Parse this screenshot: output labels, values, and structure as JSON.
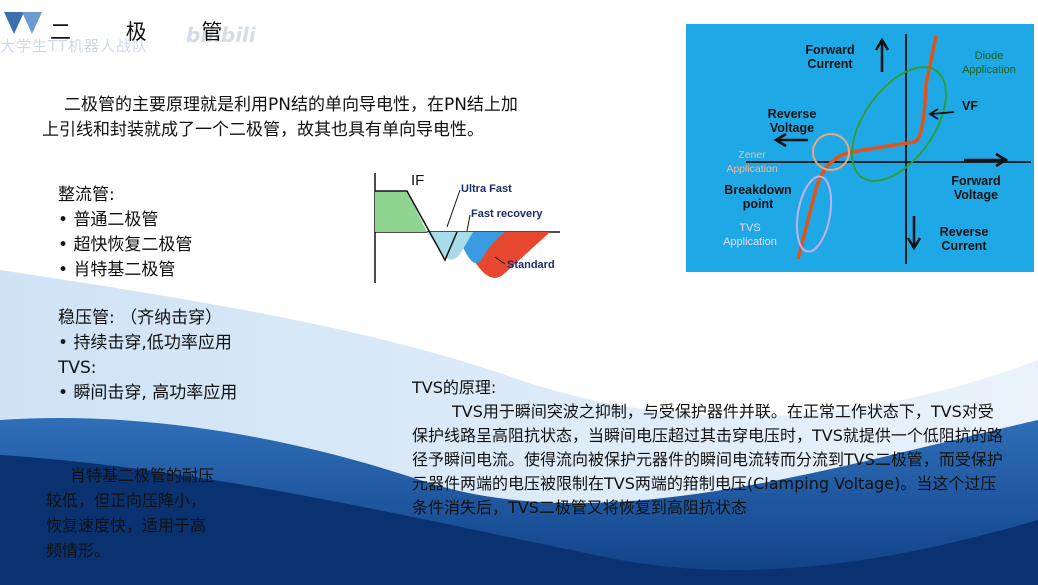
{
  "slide": {
    "title": "二 极 管",
    "watermark": "大学生TT机器人战队",
    "platform_logo": "bilibili"
  },
  "intro": "二极管的主要原理就是利用PN结的单向导电性，在PN结上加上引线和封装就成了一个二极管，故其也具有单向导电性。",
  "rectifier": {
    "heading": "整流管:",
    "items": [
      "普通二极管",
      "超快恢复二极管",
      "肖特基二极管"
    ]
  },
  "regulator": {
    "heading": "稳压管: （齐纳击穿）",
    "items": [
      "持续击穿,低功率应用"
    ],
    "tvs_heading": "TVS:",
    "tvs_items": [
      "瞬间击穿, 高功率应用"
    ]
  },
  "schottky_note": "肖特基二极管的耐压较低，但正向压降小，恢复速度快，适用于高频情形。",
  "tvs_principle": {
    "heading": "TVS的原理:",
    "body": "TVS用于瞬间突波之抑制，与受保护器件并联。在正常工作状态下，TVS对受保护线路呈高阻抗状态，当瞬间电压超过其击穿电压时，TVS就提供一个低阻抗的路径予瞬间电流。使得流向被保护元器件的瞬间电流转而分流到TVS二极管，而受保护元器件两端的电压被限制在TVS两端的箝制电压(Clamping Voltage)。当这个过压条件消失后，TVS二极管又将恢复到高阻抗状态"
  },
  "recovery_chart": {
    "if_label": "IF",
    "labels": [
      "Ultra Fast",
      "Fast recovery",
      "Standard"
    ],
    "colors": {
      "forward": "#8fd48f",
      "ultra": "#a8dcea",
      "fast": "#3a9be0",
      "standard": "#e8472f"
    }
  },
  "iv_chart": {
    "forward_current": [
      "Forward",
      "Current"
    ],
    "reverse_voltage": [
      "Reverse",
      "Voltage"
    ],
    "forward_voltage": [
      "Forward",
      "Voltage"
    ],
    "reverse_current": [
      "Reverse",
      "Current"
    ],
    "breakdown": [
      "Breakdown",
      "point"
    ],
    "diode_app": [
      "Diode",
      "Application"
    ],
    "zener_app": [
      "Zener",
      "Application"
    ],
    "tvs_app": [
      "TVS",
      "Application"
    ],
    "vf": "VF",
    "colors": {
      "panel": "#1ea9e6",
      "curve": "#e0541c",
      "diode": "#2e9e3a",
      "zener": "#f0a37d",
      "tvs": "#c3b0f0"
    }
  }
}
